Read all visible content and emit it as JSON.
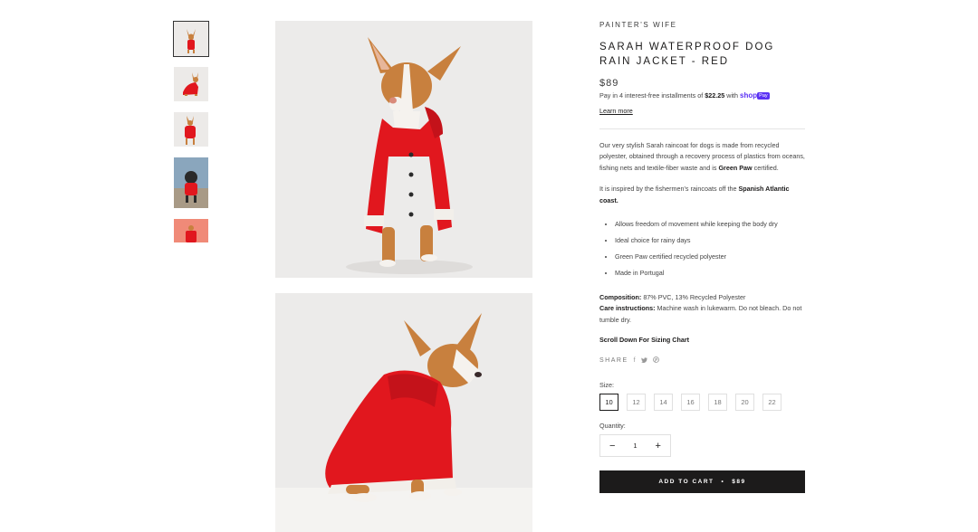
{
  "product": {
    "vendor": "PAINTER'S WIFE",
    "title": "SARAH WATERPROOF DOG RAIN JACKET - RED",
    "price": "$89",
    "installments_prefix": "Pay in 4 interest-free installments of",
    "installments_amount": "$22.25",
    "installments_with": "with",
    "shop_logo": "shop",
    "pay_badge": "Pay",
    "learn_more": "Learn more"
  },
  "description": {
    "p1_a": "Our very stylish Sarah raincoat for dogs is made from recycled polyester, obtained through a recovery process of plastics from oceans, fishing nets and textile-fiber waste and is",
    "p1_b": "Green Paw",
    "p1_c": "certified.",
    "p2_a": "It is inspired by the fishermen's raincoats off the",
    "p2_b": "Spanish Atlantic coast.",
    "bullets": [
      "Allows freedom of movement while keeping the body dry",
      "Ideal choice for rainy days",
      "Green Paw certified recycled polyester",
      "Made in Portugal"
    ],
    "composition_label": "Composition:",
    "composition": "87% PVC, 13% Recycled Polyester",
    "care_label": "Care instructions:",
    "care": "Machine wash in lukewarm. Do not bleach. Do not tumble dry.",
    "scroll_note": "Scroll Down For Sizing Chart"
  },
  "share": {
    "label": "SHARE",
    "icons": [
      "facebook-icon",
      "twitter-icon",
      "pinterest-icon"
    ]
  },
  "size_picker": {
    "label": "Size:",
    "options": [
      "10",
      "12",
      "14",
      "16",
      "18",
      "20",
      "22"
    ],
    "selected": "10"
  },
  "quantity": {
    "label": "Quantity:",
    "value": "1",
    "minus": "−",
    "plus": "+"
  },
  "cart": {
    "label": "ADD TO CART",
    "separator": "•",
    "price": "$89"
  },
  "colors": {
    "jacket_red": "#e1171e",
    "dog_tan": "#c8803e",
    "button_dark": "#1c1b1b",
    "shop_purple": "#5a31f4"
  }
}
